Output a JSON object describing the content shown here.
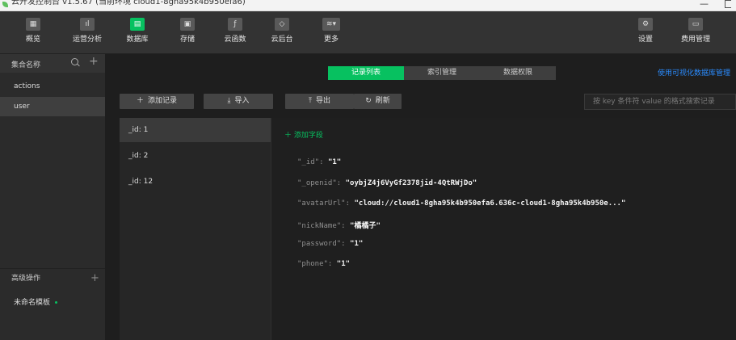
{
  "window": {
    "title": "云开发控制台 v1.5.67 (当前环境 cloud1-8gha95k4b950efa6)"
  },
  "toolbar": {
    "left_items": [
      {
        "label": "概览",
        "icon": "grid-icon"
      },
      {
        "label": "运营分析",
        "icon": "bar-chart-icon"
      },
      {
        "label": "数据库",
        "icon": "database-icon",
        "active": true
      },
      {
        "label": "存储",
        "icon": "save-icon"
      },
      {
        "label": "云函数",
        "icon": "function-icon"
      },
      {
        "label": "云后台",
        "icon": "cube-icon"
      },
      {
        "label": "更多",
        "icon": "layers-icon"
      }
    ],
    "right_items": [
      {
        "label": "设置",
        "icon": "gear-icon"
      },
      {
        "label": "费用管理",
        "icon": "wallet-icon"
      }
    ]
  },
  "sidebar": {
    "header": "集合名称",
    "collections": [
      "actions",
      "user"
    ],
    "selected": "user",
    "advanced": "高级操作",
    "template": "未命名模板"
  },
  "tabs": [
    "记录列表",
    "索引管理",
    "数据权限"
  ],
  "active_tab": "记录列表",
  "visual_link": "使用可视化数据库管理",
  "actions": {
    "add": "添加记录",
    "import": "导入",
    "export": "导出",
    "refresh": "刷新"
  },
  "search": {
    "placeholder": "按 key 条件符 value 的格式搜索记录"
  },
  "records": [
    "_id: 1",
    "_id: 2",
    "_id: 12"
  ],
  "selected_record": "_id: 1",
  "detail": {
    "add_field": "添加字段",
    "fields": [
      {
        "key": "\"_id\":",
        "value": "\"1\""
      },
      {
        "key": "\"_openid\":",
        "value": "\"oybjZ4j6VyGf2378jid-4QtRWjDo\""
      },
      {
        "key": "\"avatarUrl\":",
        "value": "\"cloud://cloud1-8gha95k4b950efa6.636c-cloud1-8gha95k4b950e...\""
      },
      {
        "key": "\"nickName\":",
        "value": "\"橘橘子\""
      },
      {
        "key": "\"password\":",
        "value": "\"1\""
      },
      {
        "key": "\"phone\":",
        "value": "\"1\""
      }
    ]
  },
  "colors": {
    "accent": "#07c160",
    "link": "#2b8cff",
    "background": "#1e1e1e"
  }
}
